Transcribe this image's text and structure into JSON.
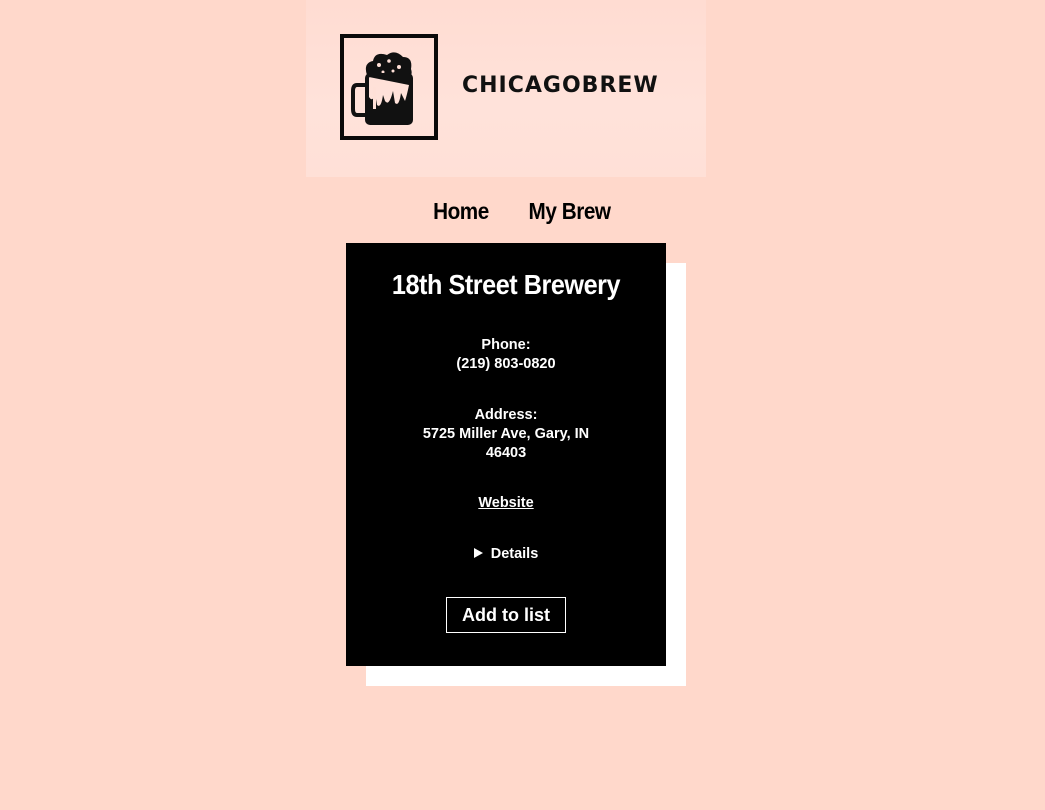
{
  "brand": {
    "logo_text": "CHICAGOBREW",
    "logo_icon": "beer-mug-icon"
  },
  "nav": {
    "items": [
      {
        "label": "Home"
      },
      {
        "label": "My Brew"
      }
    ]
  },
  "brewery": {
    "name": "18th Street Brewery",
    "phone_label": "Phone:",
    "phone": "(219) 803-0820",
    "address_label": "Address:",
    "address": "5725 Miller Ave, Gary, IN 46403",
    "website_label": "Website",
    "details_label": "Details",
    "add_button_label": "Add to list"
  },
  "colors": {
    "background": "#ffd8cb",
    "card": "#000000",
    "card_shadow": "#ffffff",
    "text_on_card": "#ffffff"
  }
}
